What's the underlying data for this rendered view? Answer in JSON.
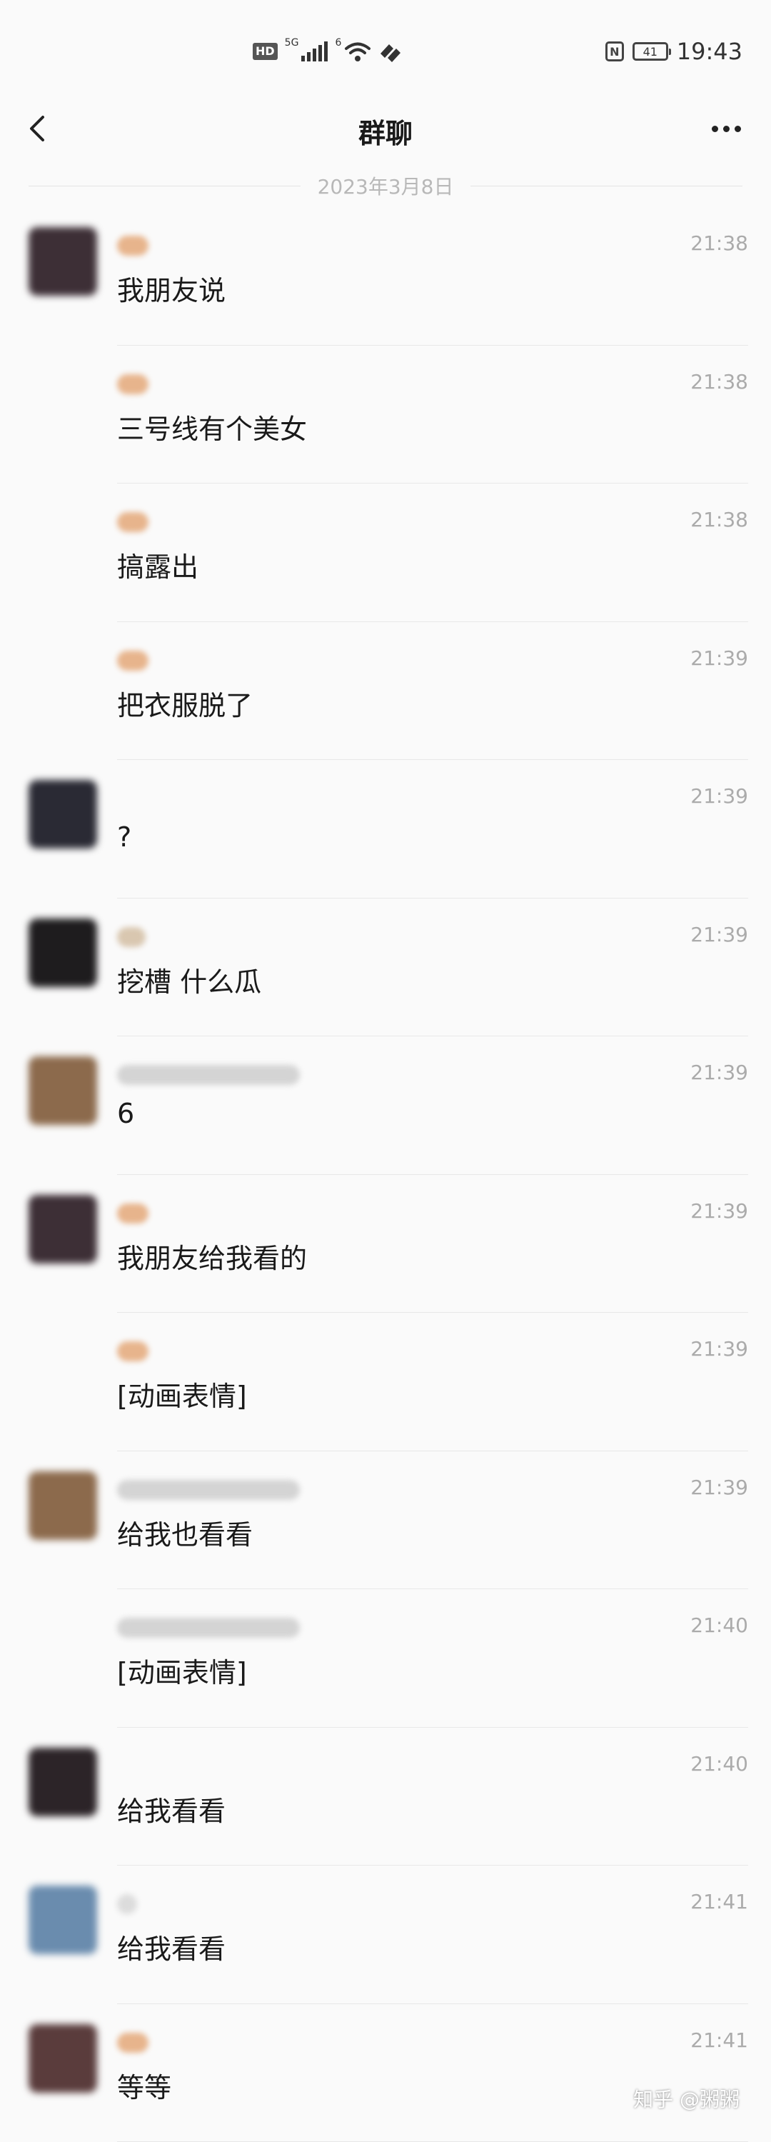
{
  "status_bar": {
    "hd": "HD",
    "signal": "5G",
    "wifi_gen": "6",
    "battery": "41",
    "time": "19:43",
    "icons": [
      "hd-icon",
      "signal-icon",
      "wifi-icon",
      "vpn-icon",
      "nfc-icon",
      "battery-icon"
    ]
  },
  "nav": {
    "title": "群聊",
    "icons": [
      "back-arrow-icon",
      "more-icon"
    ]
  },
  "date": "2023年3月8日",
  "messages": [
    {
      "time": "21:38",
      "text": "我朋友说",
      "avatar": "#3d2f36",
      "sender_color": "#e7b48c"
    },
    {
      "time": "21:38",
      "text": "三号线有个美女",
      "avatar": "",
      "sender_color": "#e7b48c"
    },
    {
      "time": "21:38",
      "text": "搞露出",
      "avatar": "",
      "sender_color": "#e7b48c"
    },
    {
      "time": "21:39",
      "text": "把衣服脱了",
      "avatar": "",
      "sender_color": "#e7b48c"
    },
    {
      "time": "21:39",
      "text": "?",
      "avatar": "#2a2a34",
      "sender_color": ""
    },
    {
      "time": "21:39",
      "text": "挖槽 什么瓜",
      "avatar": "#1e1c1e",
      "sender_color": "#d9c7b0"
    },
    {
      "time": "21:39",
      "text": "6",
      "avatar": "#8c6a4c",
      "sender_color": "#d4d4d4"
    },
    {
      "time": "21:39",
      "text": "我朋友给我看的",
      "avatar": "#3d2f36",
      "sender_color": "#e7b48c"
    },
    {
      "time": "21:39",
      "text": "[动画表情]",
      "avatar": "",
      "sender_color": "#e7b48c"
    },
    {
      "time": "21:39",
      "text": "给我也看看",
      "avatar": "#8c6a4c",
      "sender_color": "#d4d4d4"
    },
    {
      "time": "21:40",
      "text": "[动画表情]",
      "avatar": "",
      "sender_color": "#d4d4d4"
    },
    {
      "time": "21:40",
      "text": "给我看看",
      "avatar": "#2c2428",
      "sender_color": ""
    },
    {
      "time": "21:41",
      "text": "给我看看",
      "avatar": "#6a8cae",
      "sender_color": "#dcdcdc"
    },
    {
      "time": "21:41",
      "text": "等等",
      "avatar": "#5a3c3c",
      "sender_color": "#e7b48c"
    }
  ],
  "watermark": "知乎 @粥粥"
}
